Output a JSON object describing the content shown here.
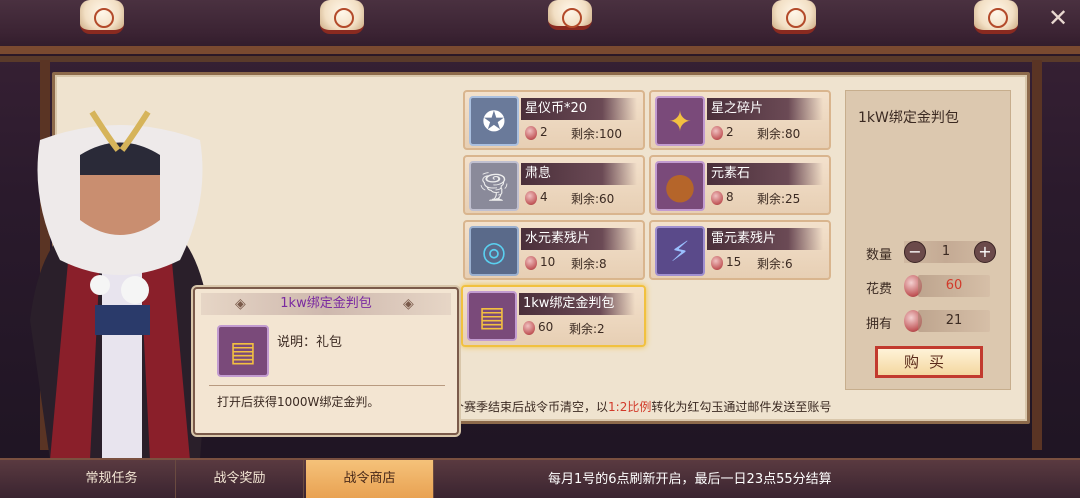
{
  "items": [
    {
      "name": "星仪币*20",
      "price": "2",
      "remain": "剩余:100",
      "icon": "star-coin-icon",
      "icon_glyph": "✪"
    },
    {
      "name": "星之碎片",
      "price": "2",
      "remain": "剩余:80",
      "icon": "star-fragment-icon",
      "icon_glyph": "✦"
    },
    {
      "name": "肃息",
      "price": "4",
      "remain": "剩余:60",
      "icon": "whirlwind-icon",
      "icon_glyph": "🌪"
    },
    {
      "name": "元素石",
      "price": "8",
      "remain": "剩余:25",
      "icon": "element-stone-icon",
      "icon_glyph": "●"
    },
    {
      "name": "水元素残片",
      "price": "10",
      "remain": "剩余:8",
      "icon": "water-element-icon",
      "icon_glyph": "◎"
    },
    {
      "name": "雷元素残片",
      "price": "15",
      "remain": "剩余:6",
      "icon": "thunder-element-icon",
      "icon_glyph": "⚡"
    },
    {
      "name": "1kw绑定金判包",
      "price": "60",
      "remain": "剩余:2",
      "icon": "gold-pack-icon",
      "icon_glyph": "▤"
    }
  ],
  "detail": {
    "title": "1kW绑定金判包",
    "qty_label": "数量",
    "qty_value": "1",
    "minus": "−",
    "plus": "+",
    "cost_label": "花费",
    "cost_value": "60",
    "own_label": "拥有",
    "own_value": "21",
    "buy_label": "购买"
  },
  "notice": {
    "prefix": "每个赛季结束后战令币清空，以",
    "ratio": "1:2比例",
    "suffix": "转化为红勾玉通过邮件发送至账号"
  },
  "tooltip": {
    "title": "1kw绑定金判包",
    "left_arrow": "◈",
    "right_arrow": "◈",
    "desc": "说明：礼包",
    "effect": "打开后获得1000W绑定金判。"
  },
  "tabs": [
    {
      "label": "常规任务"
    },
    {
      "label": "战令奖励"
    },
    {
      "label": "战令商店"
    }
  ],
  "bottom_info": "每月1号的6点刷新开启，最后一日23点55分结算",
  "close_glyph": "✕",
  "colors": {
    "accent": "#f1c13f",
    "highlight": "#d23a2a",
    "panel": "#efe3cf"
  }
}
